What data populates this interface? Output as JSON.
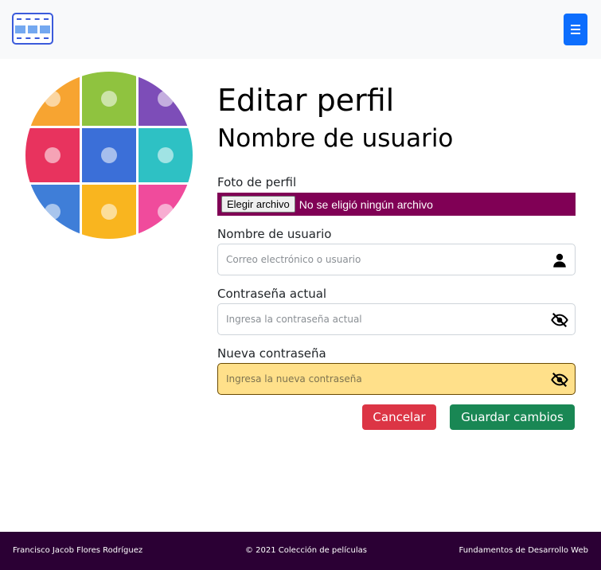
{
  "navbar": {
    "logo_icon": "film-strip-icon",
    "menu_icon": "hamburger-menu-icon"
  },
  "avatar": {
    "icon": "monster-collage-avatar",
    "tile_colors": [
      "#f7a431",
      "#8fc33f",
      "#7d4db8",
      "#e8335e",
      "#3b6fd8",
      "#2ec1c4",
      "#3f7ed8",
      "#f9b51f",
      "#f04b9c"
    ]
  },
  "profile": {
    "title": "Editar perfil",
    "subtitle": "Nombre de usuario",
    "photo_label": "Foto de perfil",
    "file_button": "Elegir archivo",
    "file_status": "No se eligió ningún archivo",
    "username_label": "Nombre de usuario",
    "username_value": "",
    "username_placeholder": "Correo electrónico o usuario",
    "current_password_label": "Contraseña actual",
    "current_password_value": "",
    "current_password_placeholder": "Ingresa la contraseña actual",
    "new_password_label": "Nueva contraseña",
    "new_password_value": "",
    "new_password_placeholder": "Ingresa la nueva contraseña",
    "cancel": "Cancelar",
    "save": "Guardar cambios"
  },
  "icons": {
    "user": "user-icon",
    "hidden": "eye-slash-icon"
  },
  "colors": {
    "file_bg": "#800055",
    "warn_bg": "#ffe08a",
    "cancel": "#dc3545",
    "save": "#198754",
    "footer_bg": "#2b0034",
    "primary": "#0d6efd"
  },
  "footer": {
    "author": "Francisco Jacob Flores Rodríguez",
    "copyright": "© 2021 Colección de películas",
    "course": "Fundamentos de Desarrollo Web"
  }
}
